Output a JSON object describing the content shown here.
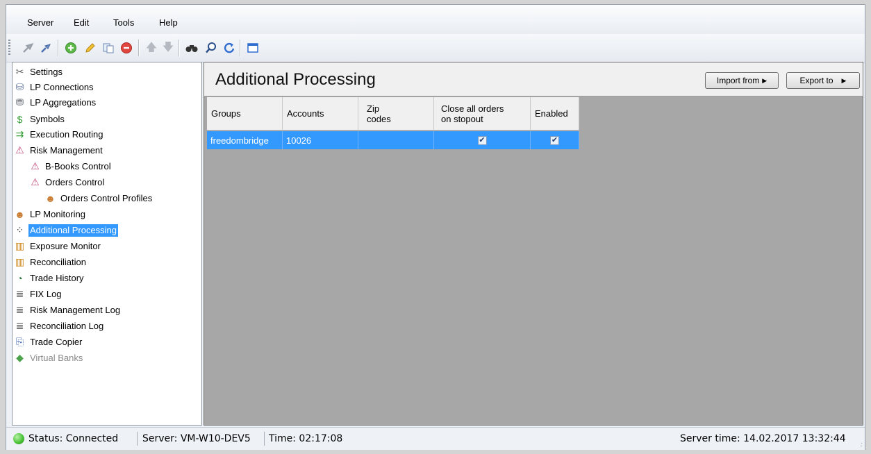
{
  "menu": [
    "Server",
    "Edit",
    "Tools",
    "Help"
  ],
  "toolbar": {
    "icons": [
      "connect-icon",
      "disconnect-icon",
      "add-icon",
      "edit-icon",
      "copy-icon",
      "delete-icon",
      "move-up-icon",
      "move-down-icon",
      "find-icon",
      "search-icon",
      "refresh-icon",
      "window-icon"
    ]
  },
  "tree": {
    "items": [
      {
        "label": "Settings",
        "icon": "settings-icon"
      },
      {
        "label": "LP Connections",
        "icon": "lp-connections-icon"
      },
      {
        "label": "LP Aggregations",
        "icon": "lp-aggregations-icon"
      },
      {
        "label": "Symbols",
        "icon": "symbols-icon"
      },
      {
        "label": "Execution Routing",
        "icon": "execution-routing-icon"
      },
      {
        "label": "Risk Management",
        "icon": "risk-management-icon"
      },
      {
        "label": "B-Books Control",
        "icon": "b-books-control-icon"
      },
      {
        "label": "Orders Control",
        "icon": "orders-control-icon"
      },
      {
        "label": "Orders Control Profiles",
        "icon": "user-icon"
      },
      {
        "label": "LP Monitoring",
        "icon": "lp-monitoring-icon"
      },
      {
        "label": "Additional Processing",
        "icon": "processing-icon",
        "selected": true
      },
      {
        "label": "Exposure Monitor",
        "icon": "exposure-monitor-icon"
      },
      {
        "label": "Reconciliation",
        "icon": "reconciliation-icon"
      },
      {
        "label": "Trade History",
        "icon": "trade-history-icon"
      },
      {
        "label": "FIX Log",
        "icon": "log-icon"
      },
      {
        "label": "Risk Management Log",
        "icon": "log-icon"
      },
      {
        "label": "Reconciliation Log",
        "icon": "log-icon"
      },
      {
        "label": "Trade Copier",
        "icon": "trade-copier-icon"
      },
      {
        "label": "Virtual Banks",
        "icon": "virtual-banks-icon",
        "disabled": true
      }
    ]
  },
  "panel": {
    "title": "Additional Processing",
    "import_label": "Import from",
    "export_label": "Export to"
  },
  "grid": {
    "columns": [
      "Groups",
      "Accounts",
      "Zip\ncodes",
      "Close all orders\non stopout",
      "Enabled"
    ],
    "rows": [
      {
        "groups": "freedombridge",
        "accounts": "10026",
        "zip_codes": "",
        "close_all_orders": true,
        "enabled": true
      }
    ]
  },
  "status": {
    "status": "Status: Connected",
    "server": "Server: VM-W10-DEV5",
    "time": "Time: 02:17:08",
    "server_time": "Server time: 14.02.2017 13:32:44",
    "indicator_color": "#4cc43a"
  }
}
